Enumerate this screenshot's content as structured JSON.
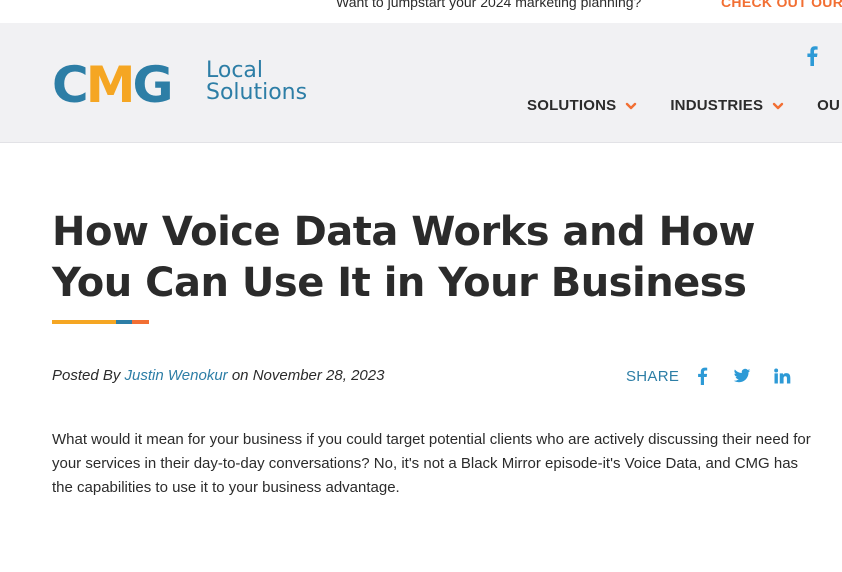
{
  "topbar": {
    "promo": "Want to jumpstart your 2024 marketing planning?",
    "cta": "CHECK OUT OUR"
  },
  "header": {
    "logo_mark": {
      "c": "C",
      "m": "M",
      "g": "G"
    },
    "logo_line1": "Local",
    "logo_line2": "Solutions",
    "nav": [
      {
        "label": "SOLUTIONS"
      },
      {
        "label": "INDUSTRIES"
      },
      {
        "label": "OU"
      }
    ]
  },
  "article": {
    "title": "How Voice Data Works and How You Can Use It in Your Business",
    "posted_by": "Posted By",
    "author": "Justin Wenokur",
    "on": "on",
    "date": "November 28, 2023",
    "share_label": "SHARE",
    "body": "What would it mean for your business if you could target potential clients who are actively discussing their need for your services in their day-to-day conversations? No, it's not a Black Mirror episode-it's Voice Data, and CMG has the capabilities to use it to your business advantage."
  },
  "colors": {
    "brand_blue": "#2d7ea6",
    "brand_orange": "#f26f33",
    "brand_yellow": "#f5a623",
    "header_bg": "#f1f1f3"
  },
  "icons": [
    "facebook-icon",
    "chevron-down-icon",
    "twitter-icon",
    "linkedin-icon"
  ]
}
